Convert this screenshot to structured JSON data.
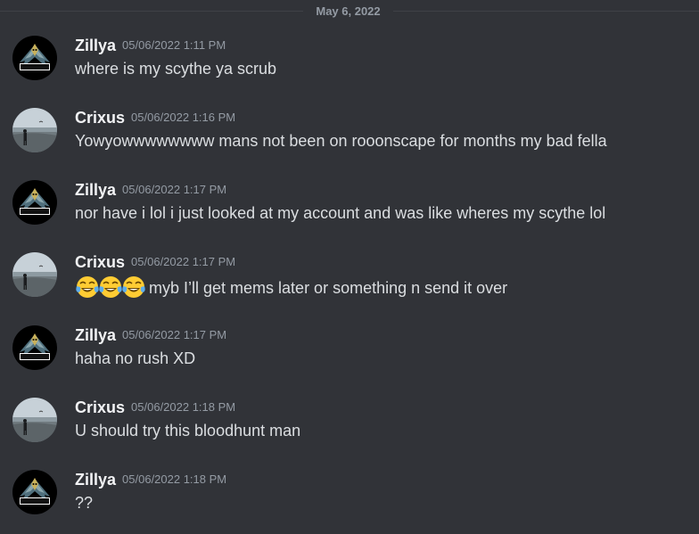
{
  "date_divider": "May 6, 2022",
  "users": {
    "zillya": {
      "name": "Zillya",
      "avatar_text": "ZILLYAR"
    },
    "crixus": {
      "name": "Crixus"
    }
  },
  "messages": [
    {
      "author": "Zillya",
      "avatar": "zillya-logo-avatar",
      "timestamp": "05/06/2022 1:11 PM",
      "text": "where is my scythe ya scrub"
    },
    {
      "author": "Crixus",
      "avatar": "lake-photo-avatar",
      "timestamp": "05/06/2022 1:16 PM",
      "text": "Yowyowwwwwwww mans not been on rooonscape for months my bad fella"
    },
    {
      "author": "Zillya",
      "avatar": "zillya-logo-avatar",
      "timestamp": "05/06/2022 1:17 PM",
      "text": "nor have i lol i just looked at my account and was like wheres my scythe lol"
    },
    {
      "author": "Crixus",
      "avatar": "lake-photo-avatar",
      "timestamp": "05/06/2022 1:17 PM",
      "emojis": [
        "joy-emoji",
        "joy-emoji",
        "joy-emoji"
      ],
      "text": "myb I’ll get mems later or something n send it over"
    },
    {
      "author": "Zillya",
      "avatar": "zillya-logo-avatar",
      "timestamp": "05/06/2022 1:17 PM",
      "text": "haha no rush XD"
    },
    {
      "author": "Crixus",
      "avatar": "lake-photo-avatar",
      "timestamp": "05/06/2022 1:18 PM",
      "text": "U should try this bloodhunt man"
    },
    {
      "author": "Zillya",
      "avatar": "zillya-logo-avatar",
      "timestamp": "05/06/2022 1:18 PM",
      "text": "??"
    }
  ],
  "colors": {
    "background": "#313338",
    "username": "#f2f3f5",
    "message_text": "#dbdee1",
    "muted": "#949ba4",
    "divider": "#3f4147"
  }
}
